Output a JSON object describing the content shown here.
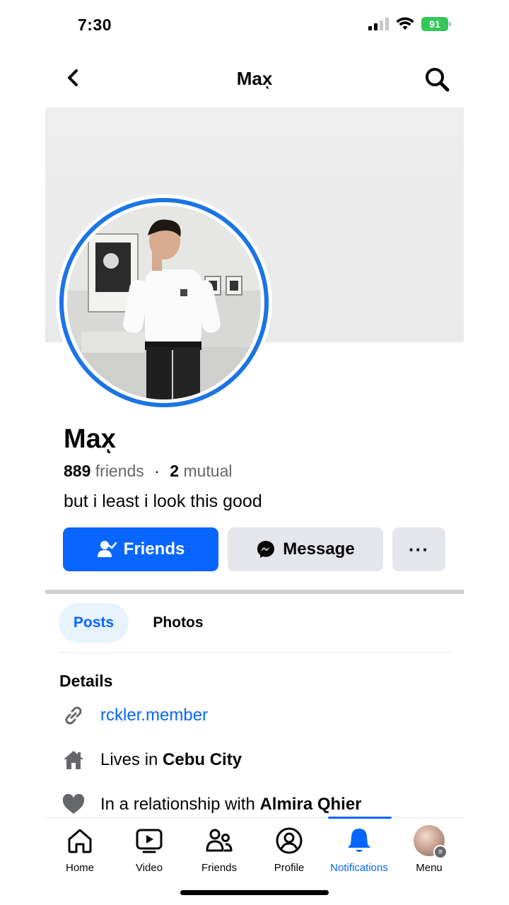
{
  "status_bar": {
    "time": "7:30",
    "battery": "91"
  },
  "header": {
    "title": "Maxͅ"
  },
  "profile": {
    "name": "Maxͅ",
    "friends_count": "889",
    "friends_label": "friends",
    "separator": "·",
    "mutual_count": "2",
    "mutual_label": "mutual",
    "bio": "but i least i look this good"
  },
  "actions": {
    "friends_label": "Friends",
    "message_label": "Message",
    "more_label": "···"
  },
  "tabs": [
    {
      "label": "Posts",
      "active": true
    },
    {
      "label": "Photos",
      "active": false
    }
  ],
  "details": {
    "title": "Details",
    "website": "rckler.member",
    "lives_prefix": "Lives in",
    "lives_city": "Cebu City",
    "relationship_prefix": "In a relationship with",
    "relationship_name": "Almira Qhier"
  },
  "bottom_nav": [
    {
      "label": "Home",
      "icon": "home-icon"
    },
    {
      "label": "Video",
      "icon": "video-icon"
    },
    {
      "label": "Friends",
      "icon": "friends-icon"
    },
    {
      "label": "Profile",
      "icon": "profile-icon"
    },
    {
      "label": "Notifications",
      "icon": "bell-icon",
      "active": true
    },
    {
      "label": "Menu",
      "icon": "menu-avatar"
    }
  ],
  "colors": {
    "accent": "#0866ff",
    "button_gray": "#e4e6eb",
    "secondary_text": "#65676b",
    "battery_green": "#34c759"
  }
}
